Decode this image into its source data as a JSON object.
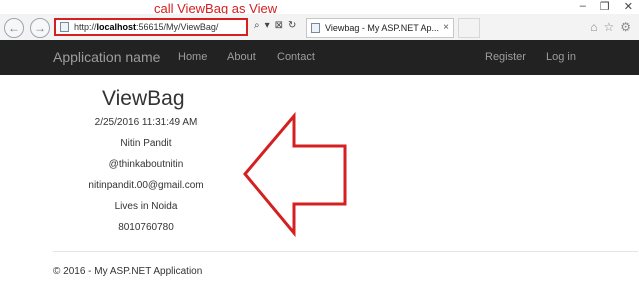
{
  "annotation": {
    "caption": "call ViewBag as View",
    "arrow_color": "#d42020"
  },
  "window_controls": {
    "minimize": "–",
    "restore": "❐",
    "close": "✕"
  },
  "browser": {
    "back_icon": "arrow-left-icon",
    "forward_icon": "arrow-right-icon",
    "url_prefix": "http://",
    "url_host": "localhost",
    "url_rest": ":56615/My/ViewBag/",
    "tools": [
      "⌕",
      "▾",
      "⊠",
      "↻"
    ],
    "tab_title": "Viewbag - My ASP.NET Ap...",
    "tab_close": "×",
    "right_icons": [
      "⌂",
      "☆",
      "⚙"
    ]
  },
  "navbar": {
    "brand": "Application name",
    "links": [
      "Home",
      "About",
      "Contact"
    ],
    "right_links": [
      "Register",
      "Log in"
    ],
    "background": "#222222"
  },
  "content": {
    "heading": "ViewBag",
    "lines": [
      "2/25/2016 11:31:49 AM",
      "Nitin Pandit",
      "@thinkaboutnitin",
      "nitinpandit.00@gmail.com",
      "Lives in Noida",
      "8010760780"
    ]
  },
  "footer": {
    "text": "© 2016 - My ASP.NET Application"
  }
}
